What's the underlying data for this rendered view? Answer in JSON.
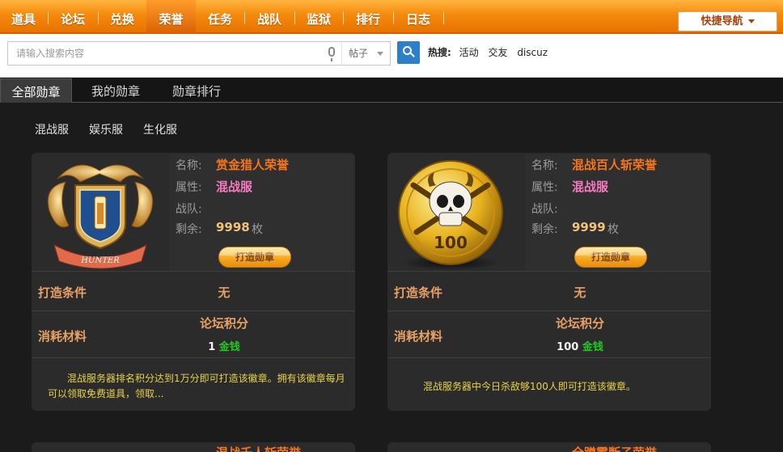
{
  "nav": {
    "items": [
      "道具",
      "论坛",
      "兑换",
      "荣誉",
      "任务",
      "战队",
      "监狱",
      "排行",
      "日志"
    ],
    "active": "荣誉",
    "quick_nav": "快捷导航"
  },
  "search": {
    "placeholder": "请输入搜索内容",
    "type": "帖子",
    "hot_label": "热搜:",
    "hot_keywords": [
      "活动",
      "交友",
      "discuz"
    ]
  },
  "tabs": [
    "全部勋章",
    "我的勋章",
    "勋章排行"
  ],
  "servers": [
    "混战服",
    "娱乐服",
    "生化服"
  ],
  "labels": {
    "name": "名称:",
    "attr": "属性:",
    "team": "战队:",
    "remain": "剩余:",
    "unit": "枚",
    "craft_button": "打造勋章",
    "craft_cond": "打造条件",
    "materials": "消耗材料"
  },
  "badges": [
    {
      "name": "赏金猎人荣誉",
      "attr": "混战服",
      "team": "",
      "remaining": "9998",
      "condition": "无",
      "material": "论坛积分",
      "qty": "1",
      "currency": "金钱",
      "description": "混战服务器排名积分达到1万分即可打造该徽章。拥有该徽章每月可以领取免费道具，领取...",
      "image": "hunter-shield-emblem",
      "image_text": "HUNTER"
    },
    {
      "name": "混战百人斩荣誉",
      "attr": "混战服",
      "team": "",
      "remaining": "9999",
      "condition": "无",
      "material": "论坛积分",
      "qty": "100",
      "currency": "金钱",
      "description": "混战服务器中今日杀敌够100人即可打造该徽章。",
      "image": "gold-skull-coin",
      "image_text": "100"
    },
    {
      "name": "混战千人斩荣誉",
      "image": "partial-badge"
    },
    {
      "name": "全蹲霸断子荣誉",
      "image": "partial-badge"
    }
  ]
}
